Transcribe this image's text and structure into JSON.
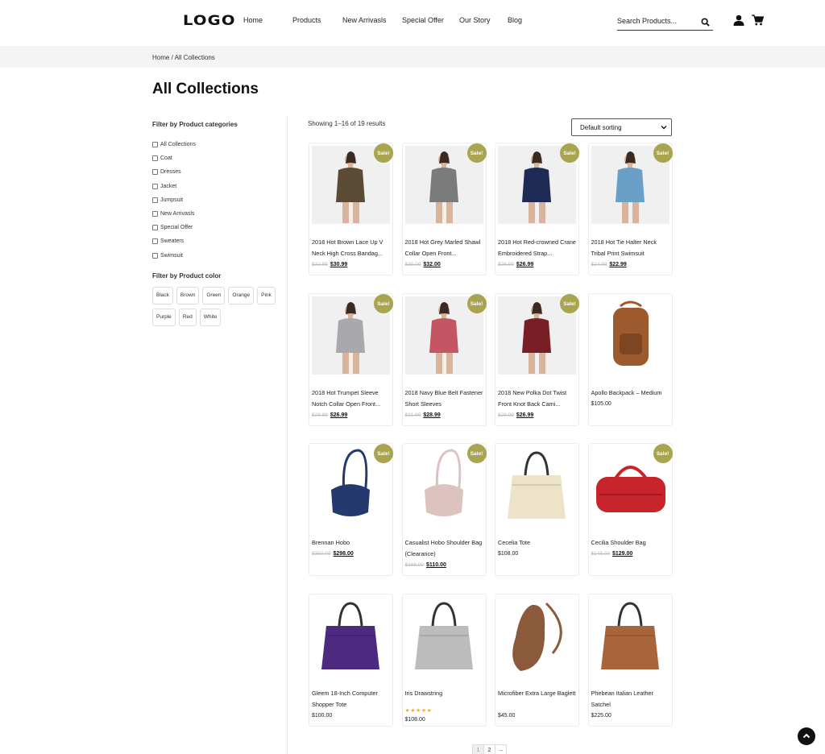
{
  "header": {
    "logo": "LOGO",
    "nav": [
      {
        "label": "Home"
      },
      {
        "label": "Products"
      },
      {
        "label": "New Arrivasls"
      },
      {
        "label": "Special Offer"
      },
      {
        "label": "Our Story"
      },
      {
        "label": "Blog"
      }
    ],
    "search_placeholder": "Search Products...",
    "icons": {
      "search": "search-icon",
      "user": "user-icon",
      "cart": "cart-icon"
    }
  },
  "breadcrumb": "Home / All Collections",
  "page_title": "All Collections",
  "sidebar": {
    "categories_title": "Filter by Product categories",
    "categories": [
      "All Collections",
      "Coat",
      "Dresses",
      "Jacket",
      "Jumpsuit",
      "New Arrivasls",
      "Special Offer",
      "Sweaters",
      "Swimsuit"
    ],
    "color_title": "Filter by Product color",
    "colors": [
      "Black",
      "Brown",
      "Green",
      "Orange",
      "Pink",
      "Purple",
      "Red",
      "White"
    ]
  },
  "results": {
    "showing": "Showing 1–16 of 19 results",
    "sorting": "Default sorting"
  },
  "sale_label": "Sale!",
  "products": [
    {
      "name": "2018 Hot Brown Lace Up V Neck High Cross Bandag...",
      "old": "$32.99",
      "price": "$30.99",
      "sale": true,
      "kind": "model",
      "color": "#5a4a36"
    },
    {
      "name": "2018 Hot Grey Marled Shawl Collar Open Front...",
      "old": "$35.00",
      "price": "$32.00",
      "sale": true,
      "kind": "model",
      "color": "#7b7b7b"
    },
    {
      "name": "2018 Hot Red-crowned Crane Embroidered Strap...",
      "old": "$28.99",
      "price": "$26.99",
      "sale": true,
      "kind": "model",
      "color": "#1f2a55"
    },
    {
      "name": "2018 Hot Tie Halter Neck Tribal Print Swimsuit",
      "old": "$24.99",
      "price": "$22.99",
      "sale": true,
      "kind": "model",
      "color": "#6a9fc7"
    },
    {
      "name": "2018 Hot Trumpet Sleeve Notch Collar Open Front...",
      "old": "$28.99",
      "price": "$26.99",
      "sale": true,
      "kind": "model",
      "color": "#a8a8ad"
    },
    {
      "name": "2018 Navy Blue Belt Fastener Short Sleeves",
      "old": "$31.99",
      "price": "$28.99",
      "sale": true,
      "kind": "model",
      "color": "#c65563"
    },
    {
      "name": "2018 New Polka Dot Twist Front Knot Back Cami...",
      "old": "$28.99",
      "price": "$26.99",
      "sale": true,
      "kind": "model",
      "color": "#7a1e25"
    },
    {
      "name": "Apollo Backpack – Medium",
      "old": "",
      "price": "$105.00",
      "sale": false,
      "kind": "backpack",
      "color": "#9c5a2e"
    },
    {
      "name": "Brennan Hobo",
      "old": "$350.00",
      "price": "$298.00",
      "sale": true,
      "kind": "hobo",
      "color": "#243a6e"
    },
    {
      "name": "Casualist Hobo Shoulder Bag (Clearance)",
      "old": "$168.00",
      "price": "$110.00",
      "sale": true,
      "kind": "hobo",
      "color": "#dcc3c0"
    },
    {
      "name": "Cecelia Tote",
      "old": "",
      "price": "$108.00",
      "sale": false,
      "kind": "tote",
      "color": "#ede3c9"
    },
    {
      "name": "Cecilia Shoulder Bag",
      "old": "$148.00",
      "price": "$129.00",
      "sale": true,
      "kind": "duffel",
      "color": "#c7252b"
    },
    {
      "name": "Gleem 18-Inch Computer Shopper Tote",
      "old": "",
      "price": "$100.00",
      "sale": false,
      "kind": "tote",
      "color": "#4d2a80"
    },
    {
      "name": "Iris Drawstring",
      "old": "",
      "price": "$108.00",
      "sale": false,
      "kind": "tote",
      "color": "#bcbcbc",
      "stars": "★★★★★"
    },
    {
      "name": "Microfiber Extra Large Baglett",
      "old": "",
      "price": "$45.00",
      "sale": false,
      "kind": "sling",
      "color": "#8a5a3a"
    },
    {
      "name": "Phebean Italian Leather Satchel",
      "old": "",
      "price": "$225.00",
      "sale": false,
      "kind": "tote",
      "color": "#a8643a"
    }
  ],
  "pagination": [
    "1",
    "2",
    "→"
  ]
}
